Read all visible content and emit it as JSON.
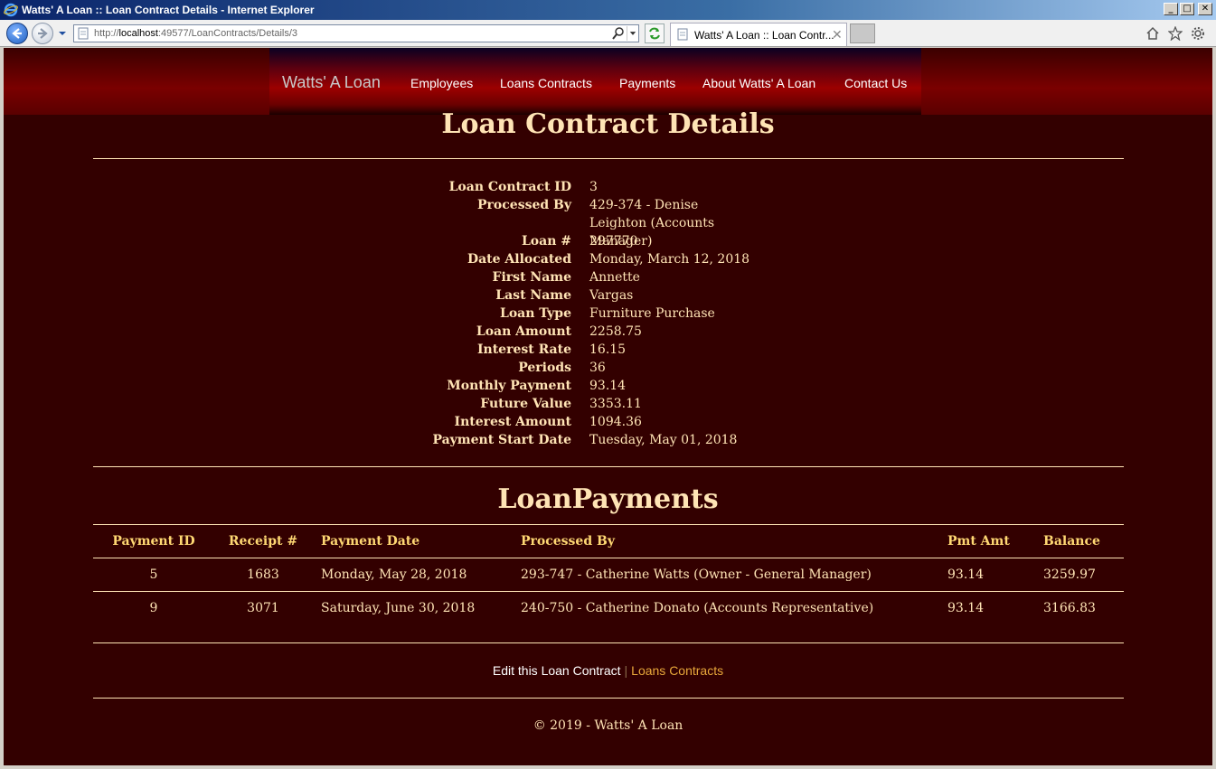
{
  "window": {
    "title": "Watts' A Loan :: Loan Contract Details - Internet Explorer",
    "minimize": "_",
    "maximize": "□",
    "close": "✕"
  },
  "browser": {
    "url_prefix": "http://",
    "url_host": "localhost",
    "url_rest": ":49577/LoanContracts/Details/3",
    "tab_title": "Watts' A Loan :: Loan Contr...",
    "tab_close": "✕"
  },
  "nav": {
    "brand": "Watts' A Loan",
    "links": [
      "Employees",
      "Loans Contracts",
      "Payments",
      "About Watts' A Loan",
      "Contact Us"
    ]
  },
  "details": {
    "heading": "Loan Contract Details",
    "fields": [
      {
        "label": "Loan Contract ID",
        "value": "3"
      },
      {
        "label": "Processed By",
        "value": "429-374 - Denise Leighton (Accounts Manager)"
      },
      {
        "label": "Loan #",
        "value": "297770"
      },
      {
        "label": "Date Allocated",
        "value": "Monday, March 12, 2018"
      },
      {
        "label": "First Name",
        "value": "Annette"
      },
      {
        "label": "Last Name",
        "value": "Vargas"
      },
      {
        "label": "Loan Type",
        "value": "Furniture Purchase"
      },
      {
        "label": "Loan Amount",
        "value": "2258.75"
      },
      {
        "label": "Interest Rate",
        "value": "16.15"
      },
      {
        "label": "Periods",
        "value": "36"
      },
      {
        "label": "Monthly Payment",
        "value": "93.14"
      },
      {
        "label": "Future Value",
        "value": "3353.11"
      },
      {
        "label": "Interest Amount",
        "value": "1094.36"
      },
      {
        "label": "Payment Start Date",
        "value": "Tuesday, May 01, 2018"
      }
    ]
  },
  "payments": {
    "heading": "LoanPayments",
    "columns": [
      "Payment ID",
      "Receipt #",
      "Payment Date",
      "Processed By",
      "Pmt Amt",
      "Balance"
    ],
    "rows": [
      [
        "5",
        "1683",
        "Monday, May 28, 2018",
        "293-747 - Catherine Watts (Owner - General Manager)",
        "93.14",
        "3259.97"
      ],
      [
        "9",
        "3071",
        "Saturday, June 30, 2018",
        "240-750 - Catherine Donato (Accounts Representative)",
        "93.14",
        "3166.83"
      ]
    ]
  },
  "actions": {
    "edit": "Edit this Loan Contract",
    "separator": "|",
    "back": "Loans Contracts"
  },
  "footer": "© 2019 - Watts' A Loan",
  "colors": {
    "page_bg": "#330000",
    "text": "#ffe4b5",
    "header_text": "#ffd873",
    "link_orange": "#e8a73a"
  }
}
